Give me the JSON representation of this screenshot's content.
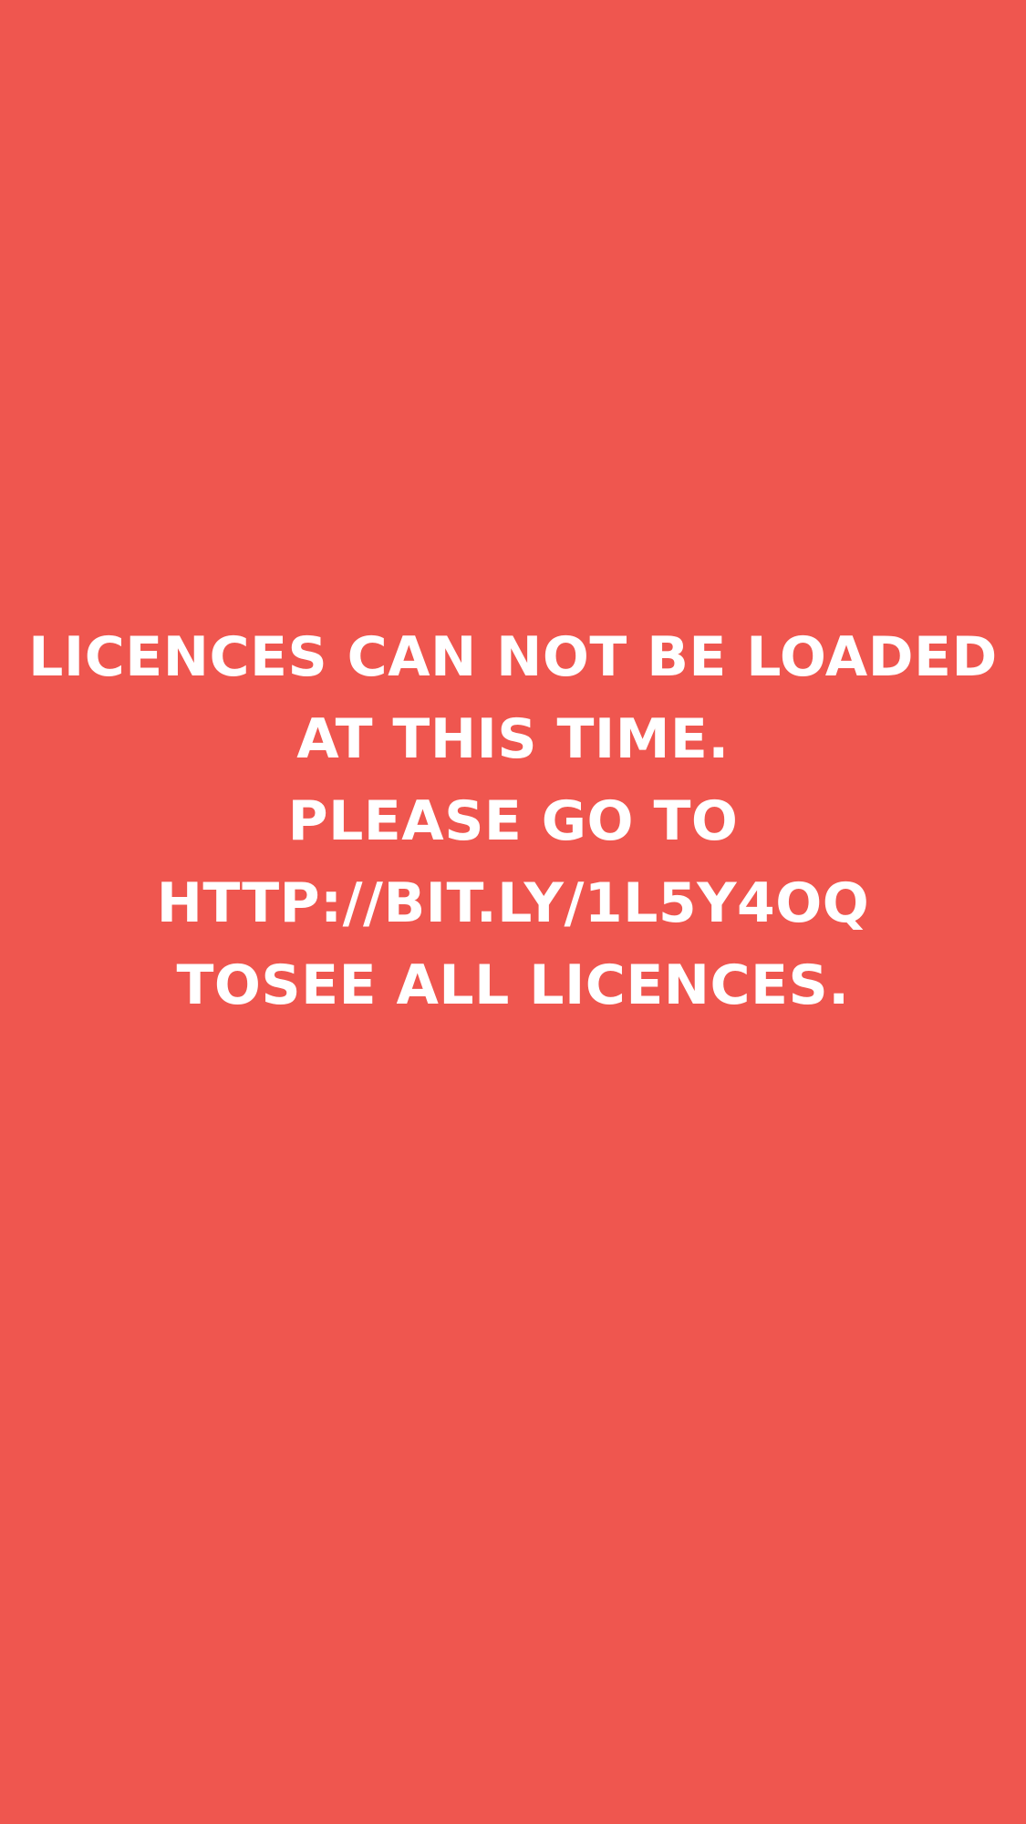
{
  "background_color": "#ef564f",
  "text_color": "#ffffff",
  "message": {
    "lines": [
      "LICENCES CAN NOT BE LOADED",
      "AT THIS TIME.",
      "PLEASE GO TO",
      "HTTP://BIT.LY/1L5Y4OQ",
      "TOSEE ALL LICENCES."
    ]
  }
}
